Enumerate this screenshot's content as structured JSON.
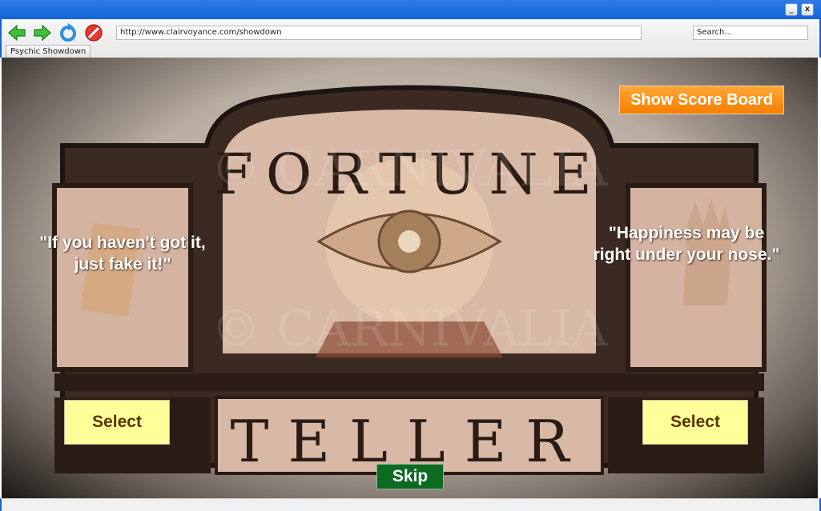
{
  "browser": {
    "url": "http://www.clairvoyance.com/showdown",
    "search_placeholder": "Search...",
    "tab_label": "Psychic Showdown",
    "minimize_label": "_",
    "close_label": "x",
    "icons": [
      "back-arrow-icon",
      "forward-arrow-icon",
      "reload-icon",
      "stop-icon"
    ]
  },
  "game": {
    "scoreboard_label": "Show Score Board",
    "quote_left": "\"If you haven't got it, just fake it!\"",
    "quote_right": "\"Happiness may be right under your nose.\"",
    "select_left_label": "Select",
    "select_right_label": "Select",
    "skip_label": "Skip",
    "sign_top_text": "FORTUNE",
    "sign_bottom_text": "TELLER",
    "watermark_text": "© CARNIVALIA"
  },
  "colors": {
    "scoreboard": "#f88a10",
    "select": "#ffff99",
    "skip": "#0c6a23",
    "window_frame": "#1464d6"
  }
}
